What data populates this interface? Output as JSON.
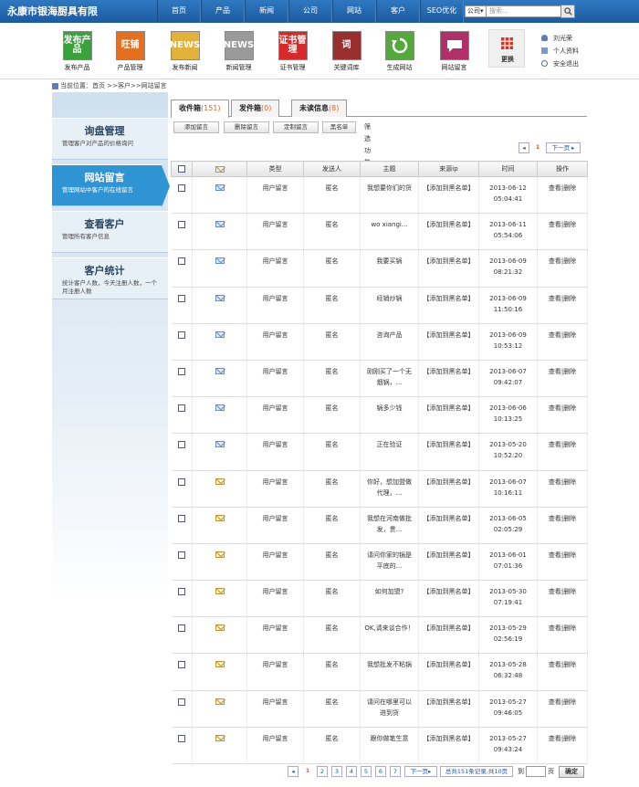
{
  "app": {
    "title": "永康市银海厨具有限"
  },
  "top_nav": [
    "首页",
    "产品",
    "新闻",
    "公司",
    "网站",
    "客户",
    "SEO优化"
  ],
  "search": {
    "scope": "公司",
    "placeholder": "搜索..."
  },
  "toolbar": {
    "items": [
      {
        "label": "发布产品",
        "icon_text": "发布产品",
        "icon": "publish-product-icon",
        "color": "#3aa23a"
      },
      {
        "label": "产品管理",
        "icon_text": "旺铺",
        "icon": "product-manage-icon",
        "color": "#e46f1e"
      },
      {
        "label": "发布新闻",
        "icon_text": "NEWS",
        "icon": "publish-news-icon",
        "color": "#e3b23c"
      },
      {
        "label": "新闻管理",
        "icon_text": "NEWS",
        "icon": "news-manage-icon",
        "color": "#9a9a9a"
      },
      {
        "label": "证书管理",
        "icon_text": "证书管理",
        "icon": "certificate-icon",
        "color": "#d62a2a"
      },
      {
        "label": "关键词库",
        "icon_text": "词",
        "icon": "keyword-icon",
        "color": "#9a2f2f"
      },
      {
        "label": "生成网站",
        "icon_text": "",
        "icon": "refresh-icon",
        "color": "#56a83d"
      },
      {
        "label": "网站留言",
        "icon_text": "",
        "icon": "message-icon",
        "color": "#b0306a"
      }
    ],
    "more_label": "更换"
  },
  "user": {
    "name": "刘光荣",
    "profile": "个人资料",
    "security": "安全退出"
  },
  "breadcrumb": "当前位置：首页 >>客户>>网站留言",
  "sidebar": [
    {
      "title": "询盘管理",
      "desc": "管理客户对产品的价格询问"
    },
    {
      "title": "网站留言",
      "desc": "管理网站中客户的在线留言",
      "active": true
    },
    {
      "title": "查看客户",
      "desc": "管理所有客户信息"
    },
    {
      "title": "客户统计",
      "desc": "统计客户人数，今天注册人数，一个月注册人数"
    }
  ],
  "tabs": [
    {
      "label": "收件箱",
      "count": "(151)",
      "active": true
    },
    {
      "label": "发件箱",
      "count": "(0)"
    },
    {
      "label": "未读信息",
      "count": "(8)"
    }
  ],
  "actions": [
    "添加留言",
    "删除留言",
    "定制留言",
    "黑名单"
  ],
  "filter_label": "筛选功能",
  "pager_top": {
    "current": "1",
    "next": "下一页"
  },
  "table": {
    "headers": [
      "",
      "",
      "类型",
      "发送人",
      "主题",
      "来源ip",
      "时间",
      "操作"
    ],
    "rows": [
      {
        "read": false,
        "type": "用户留言",
        "sender": "匿名",
        "topic": "我想要你们的货",
        "ip": "【添加到黑名单】",
        "date": "2013-06-12",
        "time": "05:04:41"
      },
      {
        "read": false,
        "type": "用户留言",
        "sender": "匿名",
        "topic": "wo xiangi...",
        "ip": "【添加到黑名单】",
        "date": "2013-06-11",
        "time": "05:54:06"
      },
      {
        "read": false,
        "type": "用户留言",
        "sender": "匿名",
        "topic": "我要买锅",
        "ip": "【添加到黑名单】",
        "date": "2013-06-09",
        "time": "08:21:32"
      },
      {
        "read": false,
        "type": "用户留言",
        "sender": "匿名",
        "topic": "经销炒锅",
        "ip": "【添加到黑名单】",
        "date": "2013-06-09",
        "time": "11:50:16"
      },
      {
        "read": false,
        "type": "用户留言",
        "sender": "匿名",
        "topic": "咨询产品",
        "ip": "【添加到黑名单】",
        "date": "2013-06-09",
        "time": "10:53:12"
      },
      {
        "read": false,
        "type": "用户留言",
        "sender": "匿名",
        "topic": "刚刚买了一个无烟锅，...",
        "ip": "【添加到黑名单】",
        "date": "2013-06-07",
        "time": "09:42:07"
      },
      {
        "read": false,
        "type": "用户留言",
        "sender": "匿名",
        "topic": "锅多少钱",
        "ip": "【添加到黑名单】",
        "date": "2013-06-06",
        "time": "10:13:25"
      },
      {
        "read": false,
        "type": "用户留言",
        "sender": "匿名",
        "topic": "正在验证",
        "ip": "【添加到黑名单】",
        "date": "2013-05-20",
        "time": "10:52:20"
      },
      {
        "read": true,
        "type": "用户留言",
        "sender": "匿名",
        "topic": "你好，想加盟做代理，...",
        "ip": "【添加到黑名单】",
        "date": "2013-06-07",
        "time": "10:16:11"
      },
      {
        "read": true,
        "type": "用户留言",
        "sender": "匿名",
        "topic": "我想在河南做批发，贵...",
        "ip": "【添加到黑名单】",
        "date": "2013-06-05",
        "time": "02:05:29"
      },
      {
        "read": true,
        "type": "用户留言",
        "sender": "匿名",
        "topic": "请问你家的锅是平底的...",
        "ip": "【添加到黑名单】",
        "date": "2013-06-01",
        "time": "07:01:36"
      },
      {
        "read": true,
        "type": "用户留言",
        "sender": "匿名",
        "topic": "如何加盟?",
        "ip": "【添加到黑名单】",
        "date": "2013-05-30",
        "time": "07:19:41"
      },
      {
        "read": true,
        "type": "用户留言",
        "sender": "匿名",
        "topic": "OK,请来谈合作！",
        "ip": "【添加到黑名单】",
        "date": "2013-05-29",
        "time": "02:56:19"
      },
      {
        "read": true,
        "type": "用户留言",
        "sender": "匿名",
        "topic": "我想批发不粘锅",
        "ip": "【添加到黑名单】",
        "date": "2013-05-28",
        "time": "06:32:48"
      },
      {
        "read": true,
        "type": "用户留言",
        "sender": "匿名",
        "topic": "请问在哪里可以进到货",
        "ip": "【添加到黑名单】",
        "date": "2013-05-27",
        "time": "09:46:05"
      },
      {
        "read": true,
        "type": "用户留言",
        "sender": "匿名",
        "topic": "跟你做笔生意",
        "ip": "【添加到黑名单】",
        "date": "2013-05-27",
        "time": "09:43:24"
      }
    ],
    "op_view": "查看",
    "op_delete": "|删除"
  },
  "pager_bottom": {
    "pages": [
      "1",
      "2",
      "3",
      "4",
      "5",
      "6",
      "7"
    ],
    "next": "下一页",
    "summary": "总共151条记录,共10页",
    "goto_prefix": "到",
    "goto_suffix": "页",
    "confirm": "确定"
  }
}
